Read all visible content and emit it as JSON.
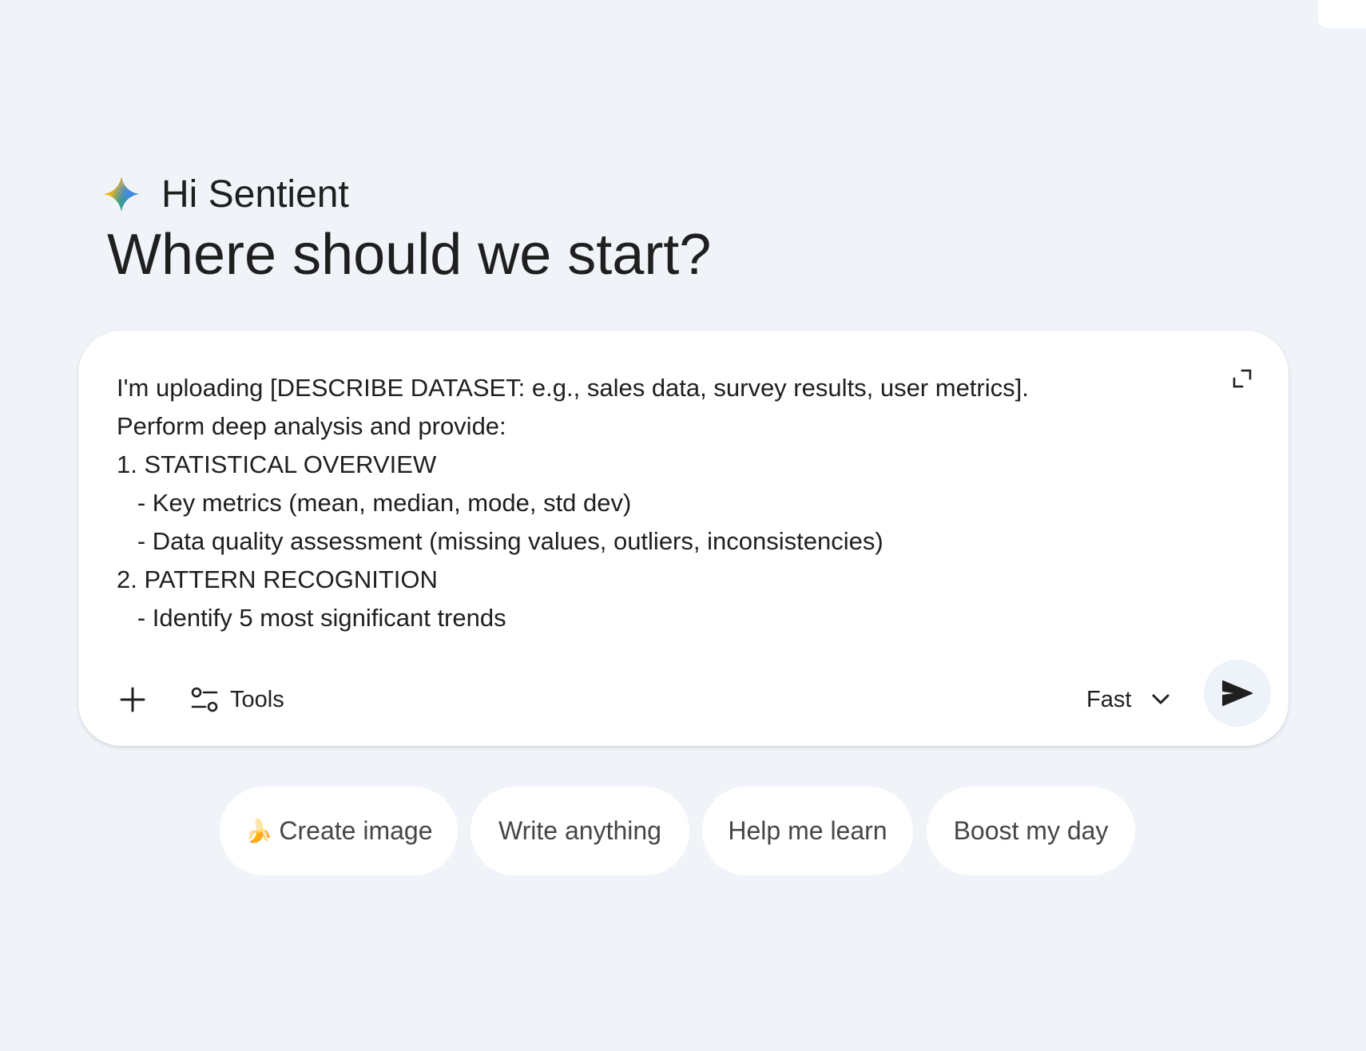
{
  "greeting": "Hi Sentient",
  "headline": "Where should we start?",
  "composer": {
    "prompt_lines": [
      "I'm uploading [DESCRIBE DATASET: e.g., sales data, survey results, user metrics].",
      "Perform deep analysis and provide:",
      "1. STATISTICAL OVERVIEW",
      "   - Key metrics (mean, median, mode, std dev)",
      "   - Data quality assessment (missing values, outliers, inconsistencies)",
      "2. PATTERN RECOGNITION",
      "   - Identify 5 most significant trends"
    ],
    "tools_label": "Tools",
    "model_label": "Fast",
    "icons": {
      "expand": "expand-icon",
      "add": "plus-icon",
      "tools": "tools-icon",
      "model_dropdown": "chevron-down-icon",
      "send": "send-icon"
    }
  },
  "chips": [
    {
      "emoji": "🍌",
      "label": "Create image"
    },
    {
      "emoji": "",
      "label": "Write anything"
    },
    {
      "emoji": "",
      "label": "Help me learn"
    },
    {
      "emoji": "",
      "label": "Boost my day"
    }
  ],
  "colors": {
    "background": "#f0f4f9",
    "surface": "#ffffff",
    "text_primary": "#1f1f1f",
    "text_chip": "#444746",
    "send_bg": "#eef2f9",
    "spark_blue": "#4285f4",
    "spark_red": "#ea4335",
    "spark_yellow": "#fbbc04",
    "spark_green": "#34a853"
  }
}
